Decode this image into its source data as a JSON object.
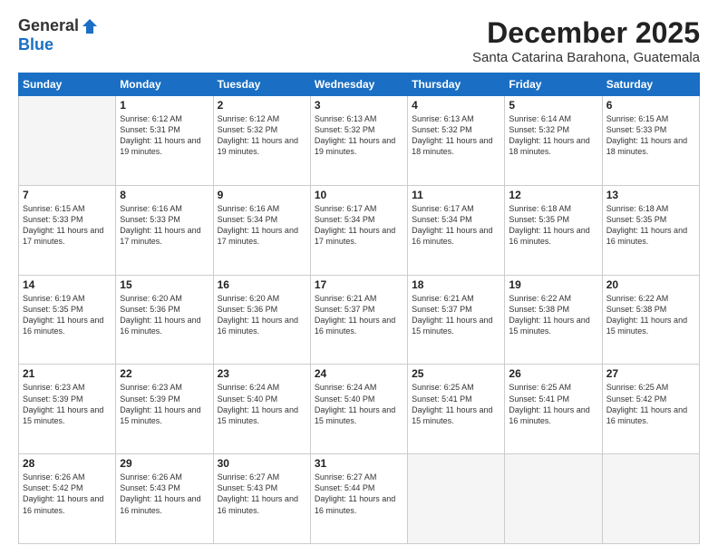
{
  "header": {
    "logo_general": "General",
    "logo_blue": "Blue",
    "month_title": "December 2025",
    "location": "Santa Catarina Barahona, Guatemala"
  },
  "days_of_week": [
    "Sunday",
    "Monday",
    "Tuesday",
    "Wednesday",
    "Thursday",
    "Friday",
    "Saturday"
  ],
  "weeks": [
    [
      {
        "day": "",
        "info": ""
      },
      {
        "day": "1",
        "info": "Sunrise: 6:12 AM\nSunset: 5:31 PM\nDaylight: 11 hours\nand 19 minutes."
      },
      {
        "day": "2",
        "info": "Sunrise: 6:12 AM\nSunset: 5:32 PM\nDaylight: 11 hours\nand 19 minutes."
      },
      {
        "day": "3",
        "info": "Sunrise: 6:13 AM\nSunset: 5:32 PM\nDaylight: 11 hours\nand 19 minutes."
      },
      {
        "day": "4",
        "info": "Sunrise: 6:13 AM\nSunset: 5:32 PM\nDaylight: 11 hours\nand 18 minutes."
      },
      {
        "day": "5",
        "info": "Sunrise: 6:14 AM\nSunset: 5:32 PM\nDaylight: 11 hours\nand 18 minutes."
      },
      {
        "day": "6",
        "info": "Sunrise: 6:15 AM\nSunset: 5:33 PM\nDaylight: 11 hours\nand 18 minutes."
      }
    ],
    [
      {
        "day": "7",
        "info": "Sunrise: 6:15 AM\nSunset: 5:33 PM\nDaylight: 11 hours\nand 17 minutes."
      },
      {
        "day": "8",
        "info": "Sunrise: 6:16 AM\nSunset: 5:33 PM\nDaylight: 11 hours\nand 17 minutes."
      },
      {
        "day": "9",
        "info": "Sunrise: 6:16 AM\nSunset: 5:34 PM\nDaylight: 11 hours\nand 17 minutes."
      },
      {
        "day": "10",
        "info": "Sunrise: 6:17 AM\nSunset: 5:34 PM\nDaylight: 11 hours\nand 17 minutes."
      },
      {
        "day": "11",
        "info": "Sunrise: 6:17 AM\nSunset: 5:34 PM\nDaylight: 11 hours\nand 16 minutes."
      },
      {
        "day": "12",
        "info": "Sunrise: 6:18 AM\nSunset: 5:35 PM\nDaylight: 11 hours\nand 16 minutes."
      },
      {
        "day": "13",
        "info": "Sunrise: 6:18 AM\nSunset: 5:35 PM\nDaylight: 11 hours\nand 16 minutes."
      }
    ],
    [
      {
        "day": "14",
        "info": "Sunrise: 6:19 AM\nSunset: 5:35 PM\nDaylight: 11 hours\nand 16 minutes."
      },
      {
        "day": "15",
        "info": "Sunrise: 6:20 AM\nSunset: 5:36 PM\nDaylight: 11 hours\nand 16 minutes."
      },
      {
        "day": "16",
        "info": "Sunrise: 6:20 AM\nSunset: 5:36 PM\nDaylight: 11 hours\nand 16 minutes."
      },
      {
        "day": "17",
        "info": "Sunrise: 6:21 AM\nSunset: 5:37 PM\nDaylight: 11 hours\nand 16 minutes."
      },
      {
        "day": "18",
        "info": "Sunrise: 6:21 AM\nSunset: 5:37 PM\nDaylight: 11 hours\nand 15 minutes."
      },
      {
        "day": "19",
        "info": "Sunrise: 6:22 AM\nSunset: 5:38 PM\nDaylight: 11 hours\nand 15 minutes."
      },
      {
        "day": "20",
        "info": "Sunrise: 6:22 AM\nSunset: 5:38 PM\nDaylight: 11 hours\nand 15 minutes."
      }
    ],
    [
      {
        "day": "21",
        "info": "Sunrise: 6:23 AM\nSunset: 5:39 PM\nDaylight: 11 hours\nand 15 minutes."
      },
      {
        "day": "22",
        "info": "Sunrise: 6:23 AM\nSunset: 5:39 PM\nDaylight: 11 hours\nand 15 minutes."
      },
      {
        "day": "23",
        "info": "Sunrise: 6:24 AM\nSunset: 5:40 PM\nDaylight: 11 hours\nand 15 minutes."
      },
      {
        "day": "24",
        "info": "Sunrise: 6:24 AM\nSunset: 5:40 PM\nDaylight: 11 hours\nand 15 minutes."
      },
      {
        "day": "25",
        "info": "Sunrise: 6:25 AM\nSunset: 5:41 PM\nDaylight: 11 hours\nand 15 minutes."
      },
      {
        "day": "26",
        "info": "Sunrise: 6:25 AM\nSunset: 5:41 PM\nDaylight: 11 hours\nand 16 minutes."
      },
      {
        "day": "27",
        "info": "Sunrise: 6:25 AM\nSunset: 5:42 PM\nDaylight: 11 hours\nand 16 minutes."
      }
    ],
    [
      {
        "day": "28",
        "info": "Sunrise: 6:26 AM\nSunset: 5:42 PM\nDaylight: 11 hours\nand 16 minutes."
      },
      {
        "day": "29",
        "info": "Sunrise: 6:26 AM\nSunset: 5:43 PM\nDaylight: 11 hours\nand 16 minutes."
      },
      {
        "day": "30",
        "info": "Sunrise: 6:27 AM\nSunset: 5:43 PM\nDaylight: 11 hours\nand 16 minutes."
      },
      {
        "day": "31",
        "info": "Sunrise: 6:27 AM\nSunset: 5:44 PM\nDaylight: 11 hours\nand 16 minutes."
      },
      {
        "day": "",
        "info": ""
      },
      {
        "day": "",
        "info": ""
      },
      {
        "day": "",
        "info": ""
      }
    ]
  ]
}
